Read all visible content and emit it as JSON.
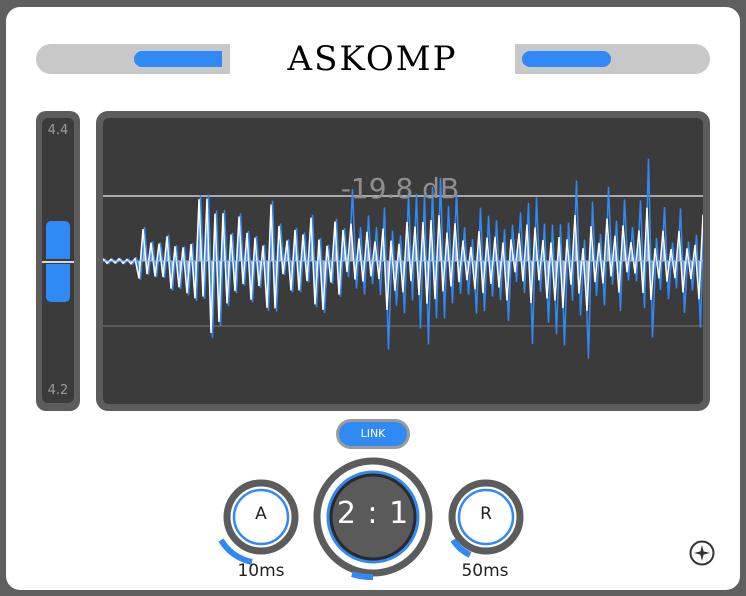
{
  "header": {
    "logo": "ASKOMP",
    "input_level": 0.5,
    "output_level": 0.5
  },
  "side_meter": {
    "top_label": "4.4",
    "bottom_label": "4.2"
  },
  "display": {
    "threshold_readout": "-19.8 dB"
  },
  "controls": {
    "link_label": "LINK",
    "attack": {
      "letter": "A",
      "value": "10ms"
    },
    "ratio": {
      "value": "2 : 1"
    },
    "release": {
      "letter": "R",
      "value": "50ms"
    }
  },
  "icons": {
    "settings": "compass-star-icon"
  },
  "colors": {
    "accent": "#2f8af6",
    "panel": "#5c5c5c",
    "screen": "#3b3b3b",
    "waveform_fill": "#b5b5b5"
  }
}
